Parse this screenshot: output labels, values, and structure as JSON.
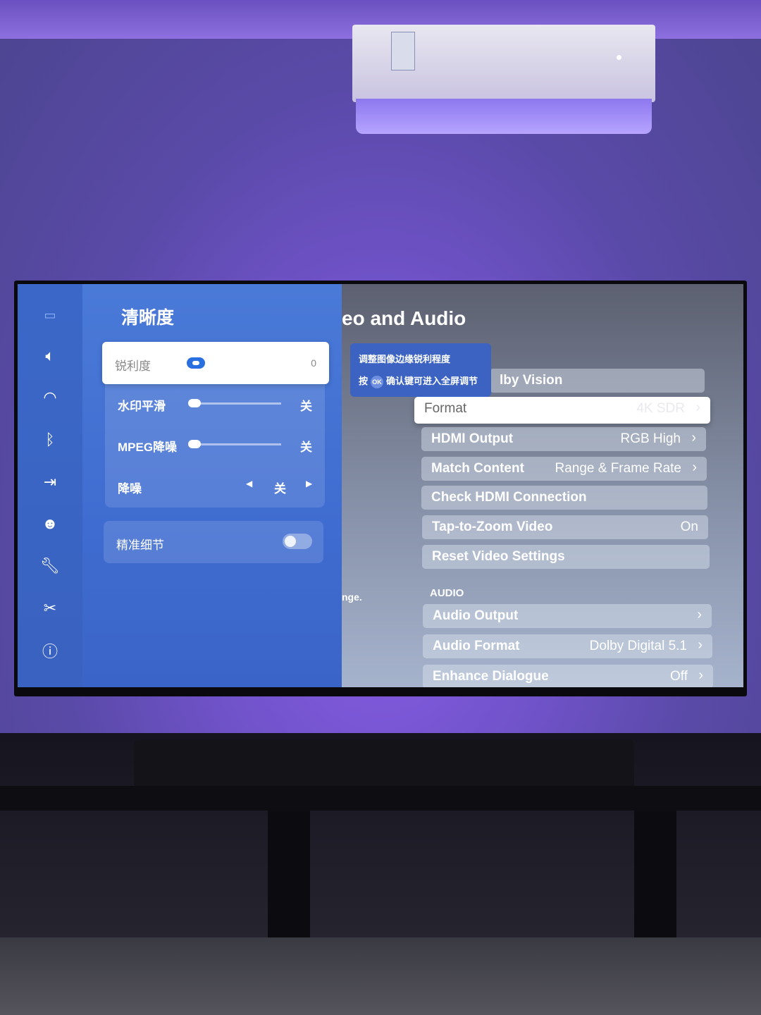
{
  "sidebar": {
    "icons": [
      "picture-icon",
      "sound-icon",
      "wifi-icon",
      "bluetooth-icon",
      "input-source-icon",
      "ai-icon",
      "wrench-icon",
      "tools-icon",
      "info-icon"
    ]
  },
  "clarity_panel": {
    "title": "清晰度",
    "sharpness": {
      "label": "锐利度",
      "value": "0"
    },
    "watermark_smoothing": {
      "label": "水印平滑",
      "value": "关",
      "level": 0
    },
    "mpeg_nr": {
      "label": "MPEG降噪",
      "value": "关",
      "level": 0
    },
    "noise_reduction": {
      "label": "降噪",
      "value": "关"
    },
    "precise_detail": {
      "label": "精准细节",
      "enabled": false
    }
  },
  "tooltip": {
    "line1": "调整图像边缘锐利程度",
    "line2_prefix": "按",
    "ok": "OK",
    "line2_suffix": "确认键可进入全屏调节"
  },
  "settings": {
    "title": "eo and Audio",
    "side_hint": "nge.",
    "video_items": [
      {
        "label": "lby Vision",
        "value": ""
      },
      {
        "label": "Format",
        "value": "4K SDR"
      },
      {
        "label": "HDMI Output",
        "value": "RGB High"
      },
      {
        "label": "Match Content",
        "value": "Range & Frame Rate"
      },
      {
        "label": "Check HDMI Connection",
        "value": ""
      },
      {
        "label": "Tap-to-Zoom Video",
        "value": "On"
      },
      {
        "label": "Reset Video Settings",
        "value": ""
      }
    ],
    "audio_header": "AUDIO",
    "audio_items": [
      {
        "label": "Audio Output",
        "value": ""
      },
      {
        "label": "Audio Format",
        "value": "Dolby Digital 5.1"
      },
      {
        "label": "Enhance Dialogue",
        "value": "Off"
      }
    ]
  },
  "colors": {
    "accent": "#2a6fe0",
    "panel": "#4172d2"
  }
}
